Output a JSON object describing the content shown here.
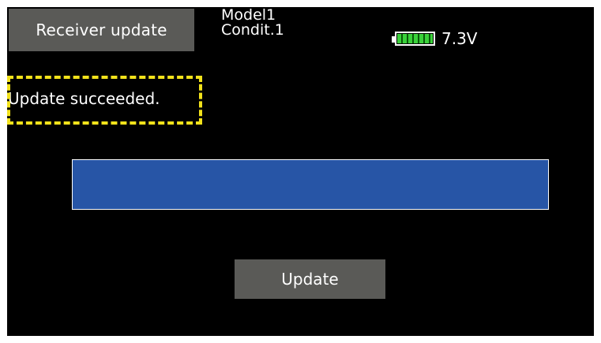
{
  "header": {
    "title_button_label": "Receiver update",
    "model_name": "Model1",
    "condition": "Condit.1",
    "battery_level": 1.0,
    "voltage": "7.3V"
  },
  "status": {
    "message": "Update succeeded."
  },
  "progress": {
    "value_percent": 100,
    "color": "#2755a6"
  },
  "actions": {
    "update_label": "Update"
  },
  "colors": {
    "background": "#000000",
    "button": "#5a5a57",
    "highlight": "#f2e21b",
    "battery": "#3bd13b"
  }
}
